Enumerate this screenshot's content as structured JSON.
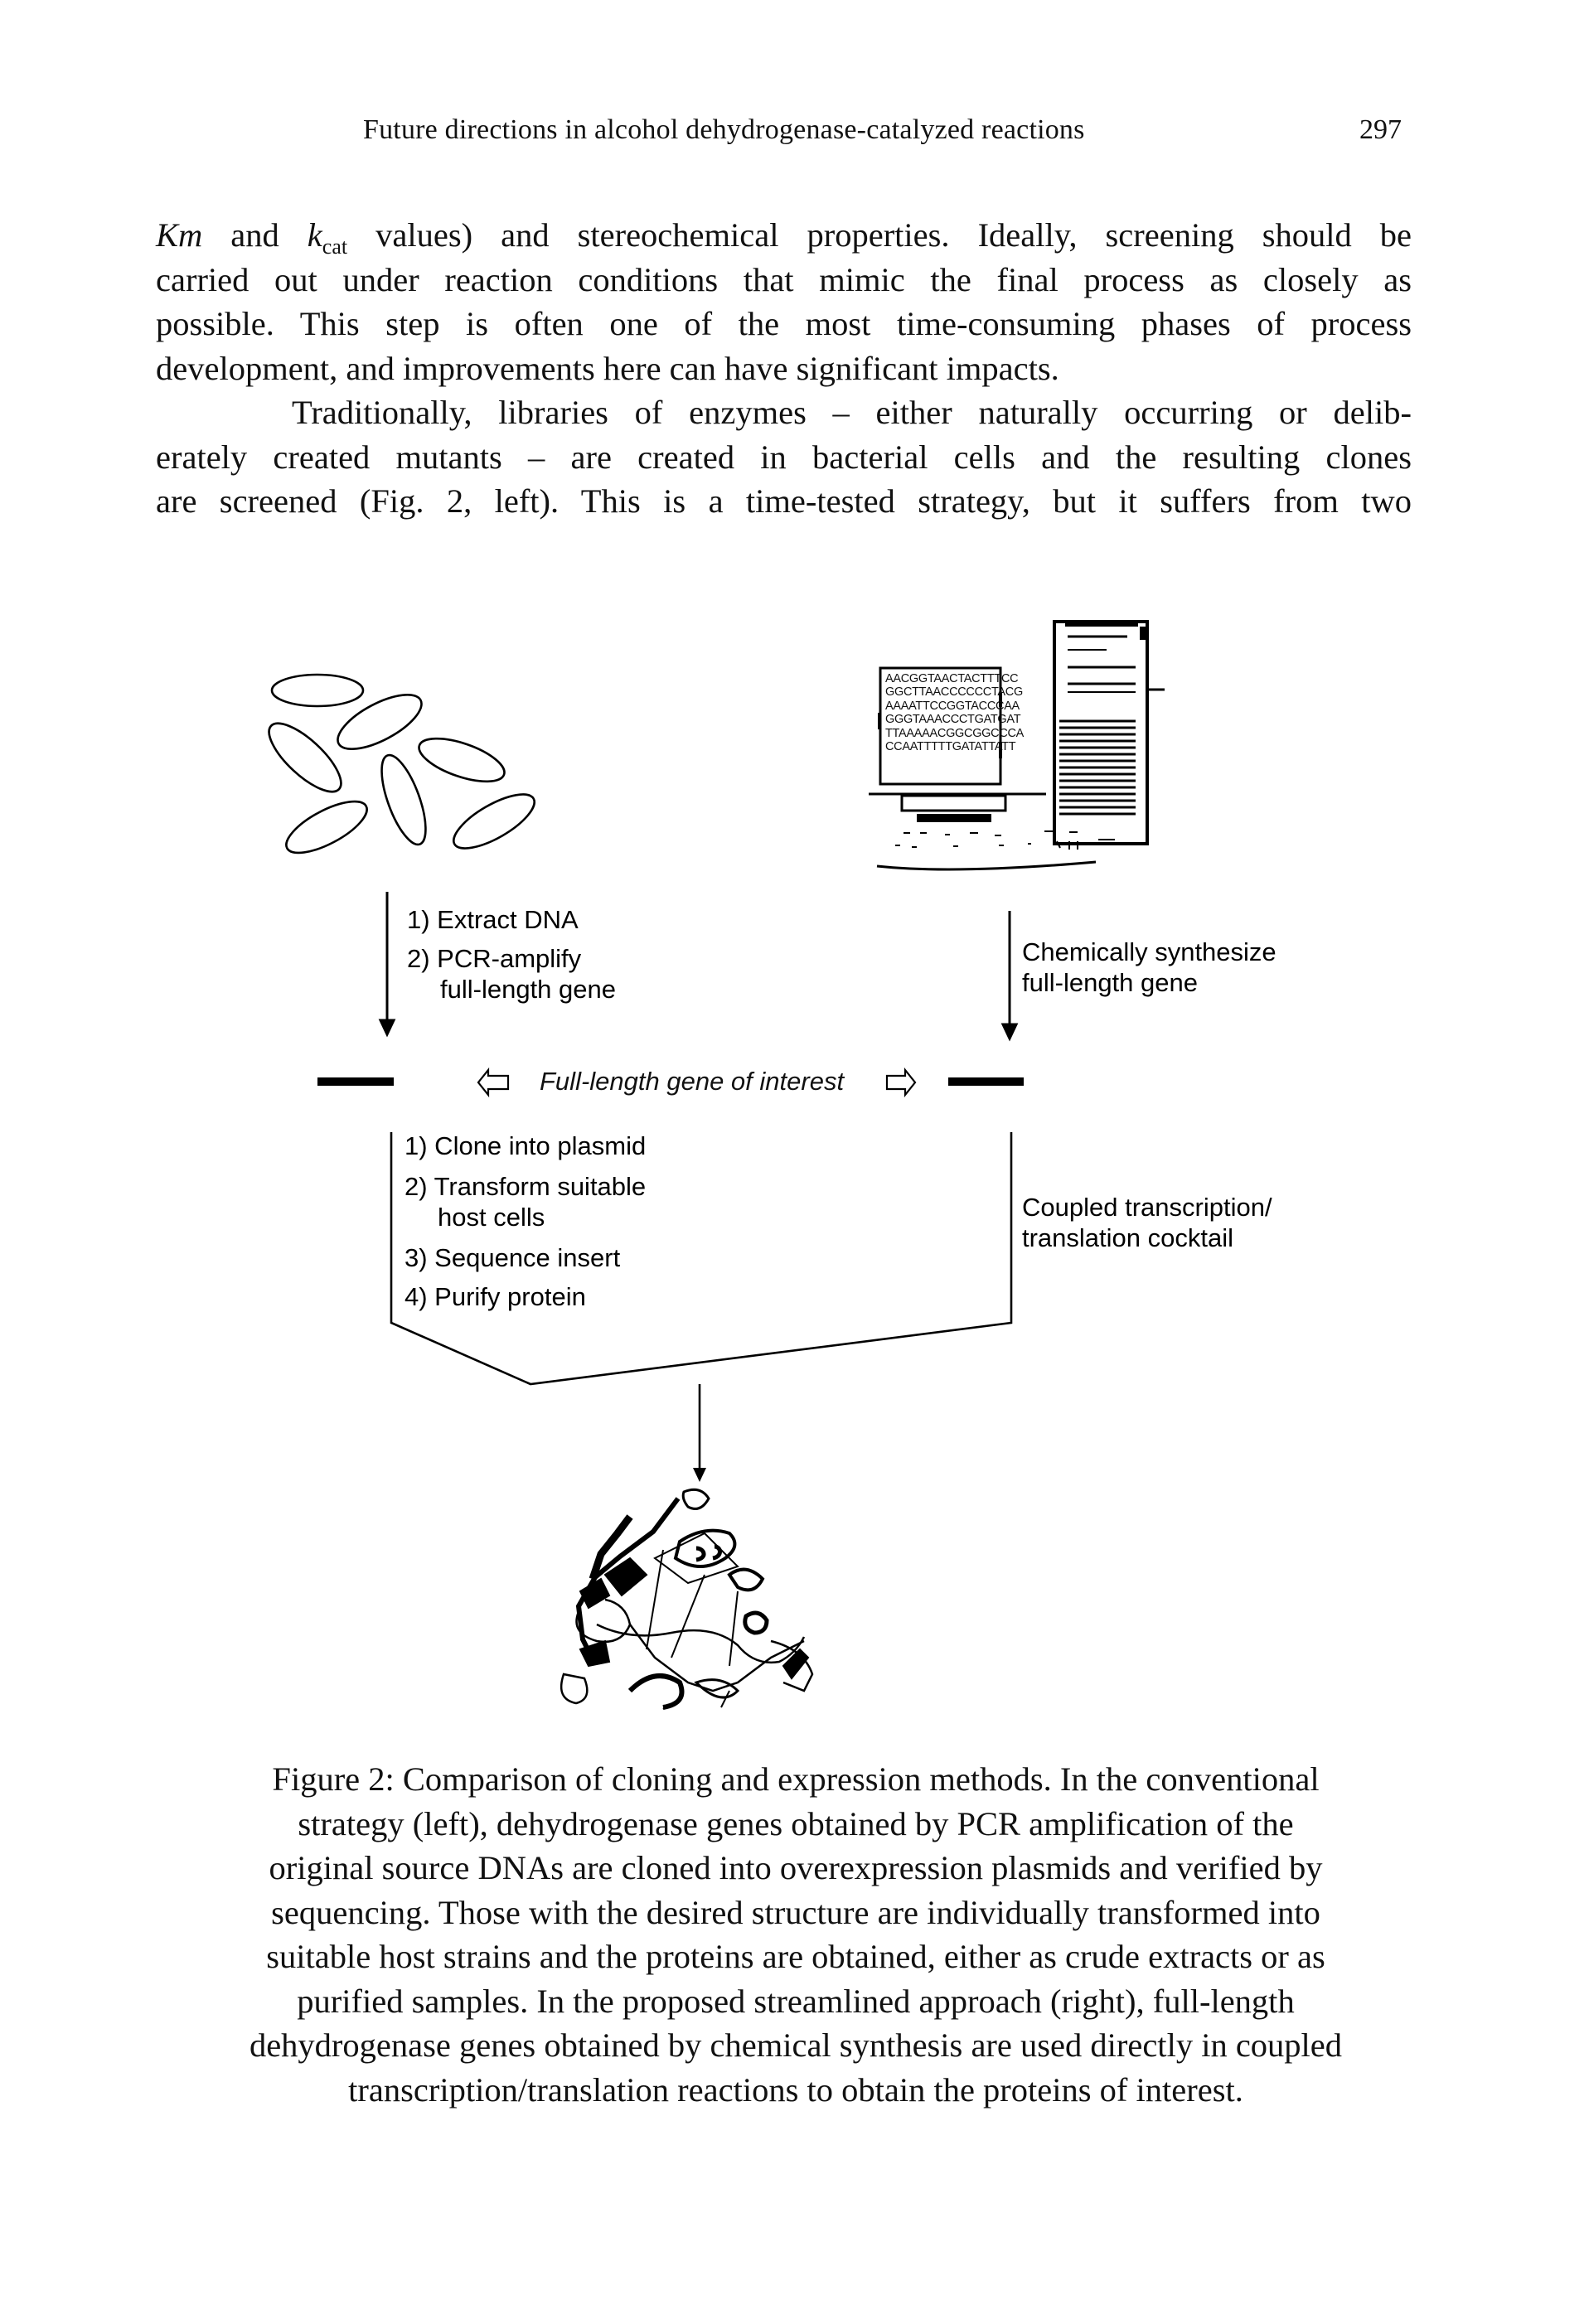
{
  "header": {
    "running_title": "Future directions in alcohol dehydrogenase-catalyzed reactions",
    "page_number": "297"
  },
  "body": {
    "paragraph1": {
      "line1_km": "Km",
      "line1_and": " and ",
      "line1_k": "k",
      "line1_k_sub": "cat",
      "line1_rest": " values) and stereochemical properties. Ideally, screening should be",
      "line2": "carried out under reaction conditions that mimic the final process as closely as",
      "line3": "possible. This step is often one of the most time-consuming phases of process",
      "line4": "development, and improvements here can have significant impacts."
    },
    "paragraph2": {
      "line1": "Traditionally, libraries of enzymes – either naturally occurring or delib-",
      "line2": "erately created mutants – are created in bacterial cells and the resulting clones",
      "line3": "are screened (Fig. 2, left). This is a time-tested strategy, but it suffers from two"
    }
  },
  "figure": {
    "left_branch": {
      "icon": "bacterial-cells-icon",
      "steps_top": [
        "1) Extract DNA",
        "2) PCR-amplify",
        "full-length gene"
      ],
      "steps_bottom": [
        "1) Clone into plasmid",
        "2) Transform suitable",
        "host cells",
        "3) Sequence insert",
        "4) Purify protein"
      ]
    },
    "right_branch": {
      "icon": "computer-icon",
      "screen_sequences": [
        "AACGGTAACTACTTTCC",
        "GGCTTAACCCCCCTACG",
        "AAAATTCCGGTACCCAA",
        "GGGTAAACCCTGATGAT",
        "TTAAAAACGGCGGCCCA",
        "CCAATTTTTGATATTATT"
      ],
      "step_top": [
        "Chemically synthesize",
        "full-length gene"
      ],
      "step_bottom": [
        "Coupled transcription/",
        "translation cocktail"
      ]
    },
    "center_label": "Full-length gene of interest",
    "result_icon": "protein-structure-icon"
  },
  "caption": {
    "lines": [
      "Figure 2: Comparison of cloning and expression methods. In the conventional",
      "strategy (left), dehydrogenase genes obtained by PCR amplification of the",
      "original source DNAs are cloned into overexpression plasmids and verified by",
      "sequencing. Those with the desired structure are individually transformed into",
      "suitable host strains and the proteins are obtained, either as crude extracts or as",
      "purified samples. In the proposed streamlined approach (right), full-length",
      "dehydrogenase genes obtained by chemical synthesis are used directly in coupled",
      "transcription/translation reactions to obtain the proteins of interest."
    ]
  }
}
